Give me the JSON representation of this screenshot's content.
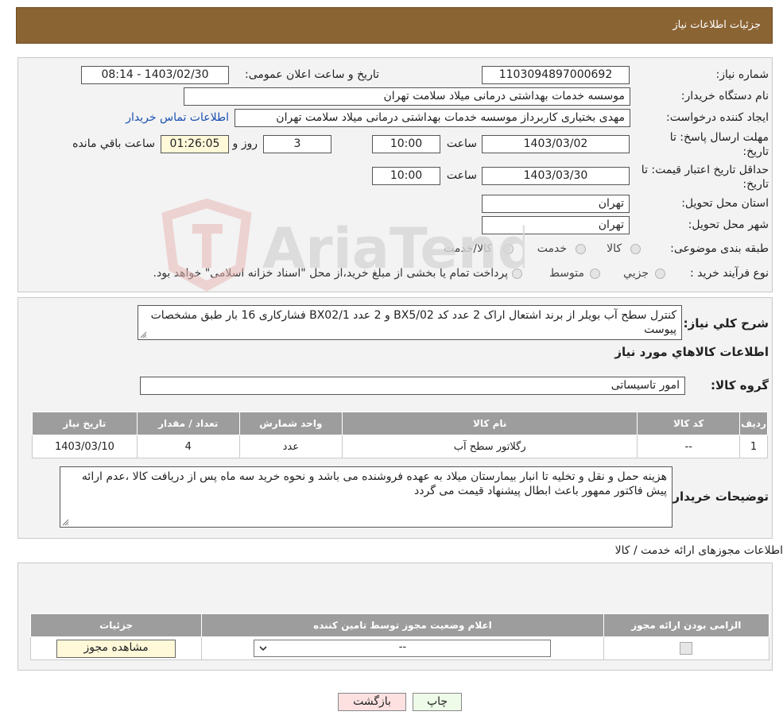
{
  "header": {
    "title": "جزئیات اطلاعات نیاز"
  },
  "details": {
    "need_number_label": "شماره نیاز:",
    "need_number": "1103094897000692",
    "announce_label": "تاریخ و ساعت اعلان عمومی:",
    "announce_value": "1403/02/30 - 08:14",
    "buyer_org_label": "نام دستگاه خریدار:",
    "buyer_org": "موسسه خدمات بهداشتی درمانی میلاد سلامت تهران",
    "creator_label": "ایجاد کننده درخواست:",
    "creator": "مهدی بختیاری کاربرداز موسسه خدمات بهداشتی درمانی میلاد سلامت تهران",
    "contact_link": "اطلاعات تماس خریدار",
    "deadline_label_1": "مهلت ارسال پاسخ: تا",
    "deadline_label_2": "تاریخ:",
    "deadline_date": "1403/03/02",
    "time_label": "ساعت",
    "deadline_time": "10:00",
    "days_value": "3",
    "days_label": "روز و",
    "remaining_value": "01:26:05",
    "remaining_label": "ساعت باقي مانده",
    "validity_label_1": "حداقل تاریخ اعتبار قیمت: تا",
    "validity_label_2": "تاریخ:",
    "validity_date": "1403/03/30",
    "validity_time_label": "ساعت",
    "validity_time": "10:00",
    "province_label": "استان محل تحویل:",
    "province": "تهران",
    "city_label": "شهر محل تحویل:",
    "city": "تهران",
    "category_label": "طبقه بندی موضوعی:",
    "category_options": [
      "کالا",
      "خدمت",
      "کالا/خدمت"
    ],
    "process_label": "نوع فرآیند خرید :",
    "process_options": [
      "جزیي",
      "متوسط"
    ],
    "process_note": "پرداخت تمام یا بخشی از مبلغ خرید،از محل \"اسناد خزانه اسلامی\" خواهد بود."
  },
  "summary": {
    "desc_label": "شرح کلي نياز:",
    "description": "کنترل سطح آب بویلر از برند اشتعال اراک 2 عدد کد BX5/02 و 2 عدد BX02/1 فشارکاری 16 بار طبق مشخصات پیوست",
    "goods_info_title": "اطلاعات کالاهاي مورد نياز",
    "group_label": "گروه کالا:",
    "group_value": "امور تاسیساتی",
    "table_headers": [
      "ردیف",
      "کد کالا",
      "نام کالا",
      "واحد شمارش",
      "تعداد / مقدار",
      "تاریخ نیاز"
    ],
    "table_rows": [
      [
        "1",
        "--",
        "رگلاتور سطح آب",
        "عدد",
        "4",
        "1403/03/10"
      ]
    ],
    "buyer_notes_label": "توضیحات خریدار:",
    "buyer_notes": "هزینه حمل و نقل و تخلیه تا انبار بیمارستان میلاد به عهده فروشنده می باشد و نحوه خرید سه ماه پس از دریافت کالا ،عدم ارائه پیش فاکتور ممهور باعث ابطال پیشنهاد قیمت می گردد"
  },
  "permits": {
    "title": "اطلاعات مجوزهای ارائه خدمت / کالا",
    "headers": [
      "الزامی بودن ارائه مجوز",
      "اعلام وضعیت مجوز توسط تامین کننده",
      "جزئیات"
    ],
    "status_select": "--",
    "view_button": "مشاهده مجوز"
  },
  "buttons": {
    "print": "چاپ",
    "back": "بازگشت"
  },
  "watermark": {
    "text": "AriaTender.neT"
  },
  "colors": {
    "header_bg": "#8b6434",
    "table_header": "#9d9d9d",
    "link": "#1a4fb3"
  }
}
